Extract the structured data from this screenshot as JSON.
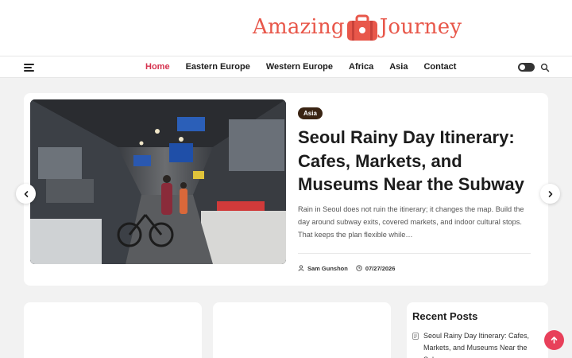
{
  "site": {
    "logo_left": "Amazing",
    "logo_right": "Journey",
    "brand_color": "#e8574a",
    "accent_color": "#d6334f"
  },
  "nav": {
    "items": [
      {
        "label": "Home",
        "active": true
      },
      {
        "label": "Eastern Europe",
        "active": false
      },
      {
        "label": "Western Europe",
        "active": false
      },
      {
        "label": "Africa",
        "active": false
      },
      {
        "label": "Asia",
        "active": false
      },
      {
        "label": "Contact",
        "active": false
      }
    ],
    "menu_icon": "hamburger-icon",
    "theme_toggle_icon": "dark-mode-toggle",
    "search_icon": "search-icon"
  },
  "hero": {
    "category": "Asia",
    "title": "Seoul Rainy Day Itinerary: Cafes, Markets, and Museums Near the Subway",
    "excerpt": "Rain in Seoul does not ruin the itinerary; it changes the map. Build the day around subway exits, covered markets, and indoor cultural stops. That keeps the plan flexible while…",
    "author": "Sam Gunshon",
    "date": "07/27/2026",
    "image_alt": "covered market alley with shops and a cyclist",
    "author_icon": "user-icon",
    "date_icon": "clock-icon"
  },
  "slider": {
    "prev_icon": "chevron-left-icon",
    "next_icon": "chevron-right-icon"
  },
  "sidebar": {
    "title": "Recent Posts",
    "items": [
      {
        "label": "Seoul Rainy Day Itinerary: Cafes, Markets, and Museums Near the Subway"
      }
    ]
  },
  "back_to_top_icon": "arrow-up-icon"
}
